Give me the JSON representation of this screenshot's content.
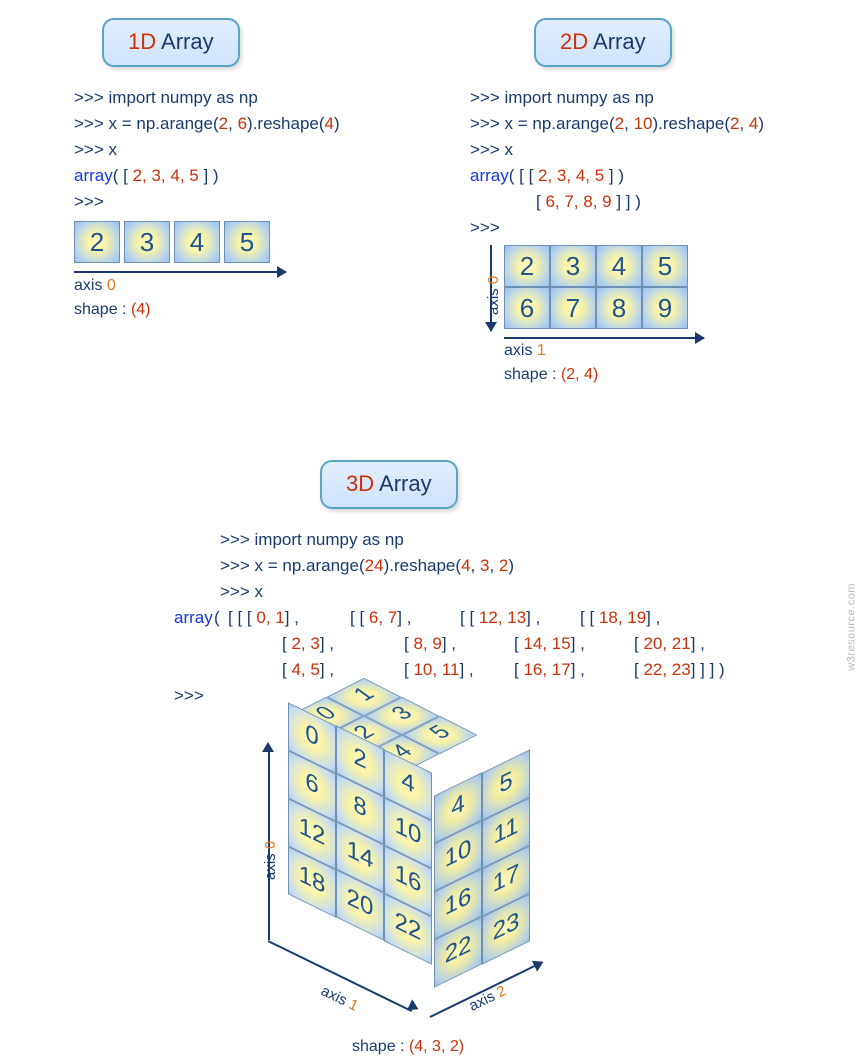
{
  "sections": {
    "d1": {
      "title_dim": "1D",
      "title_word": "Array",
      "code_lines": [
        {
          "prompt": ">>>",
          "parts": [
            {
              "t": " import numpy as np",
              "c": "kw-imp"
            }
          ]
        },
        {
          "prompt": ">>>",
          "parts": [
            {
              "t": " x =  np.arange",
              "c": "kw-fn"
            },
            {
              "t": "(",
              "c": "kw-fn"
            },
            {
              "t": "2",
              "c": "num"
            },
            {
              "t": ", ",
              "c": "kw-fn"
            },
            {
              "t": "6",
              "c": "num"
            },
            {
              "t": ")",
              "c": "kw-fn"
            },
            {
              "t": ".reshape",
              "c": "kw-fn"
            },
            {
              "t": "(",
              "c": "kw-fn"
            },
            {
              "t": "4",
              "c": "num"
            },
            {
              "t": ")",
              "c": "kw-fn"
            }
          ]
        },
        {
          "prompt": ">>>",
          "parts": [
            {
              "t": " x",
              "c": "kw-fn"
            }
          ]
        },
        {
          "prompt": "",
          "parts": [
            {
              "t": "array",
              "c": "kw-arr"
            },
            {
              "t": "( [ ",
              "c": "kw-fn"
            },
            {
              "t": "2, 3, 4, 5",
              "c": "num"
            },
            {
              "t": " ] )",
              "c": "kw-fn"
            }
          ]
        },
        {
          "prompt": ">>>",
          "parts": []
        }
      ],
      "cells": [
        "2",
        "3",
        "4",
        "5"
      ],
      "axis_label_pre": "axis ",
      "axis_label_num": "0",
      "shape_pre": "shape : ",
      "shape_val": "(4)"
    },
    "d2": {
      "title_dim": "2D",
      "title_word": "Array",
      "code_lines": [
        {
          "prompt": ">>>",
          "parts": [
            {
              "t": " import numpy as np",
              "c": "kw-imp"
            }
          ]
        },
        {
          "prompt": ">>>",
          "parts": [
            {
              "t": " x =  np.arange",
              "c": "kw-fn"
            },
            {
              "t": "(",
              "c": "kw-fn"
            },
            {
              "t": "2",
              "c": "num"
            },
            {
              "t": ", ",
              "c": "kw-fn"
            },
            {
              "t": "10",
              "c": "num"
            },
            {
              "t": ")",
              "c": "kw-fn"
            },
            {
              "t": ".reshape",
              "c": "kw-fn"
            },
            {
              "t": "(",
              "c": "kw-fn"
            },
            {
              "t": "2",
              "c": "num"
            },
            {
              "t": ", ",
              "c": "kw-fn"
            },
            {
              "t": "4",
              "c": "num"
            },
            {
              "t": ")",
              "c": "kw-fn"
            }
          ]
        },
        {
          "prompt": ">>>",
          "parts": [
            {
              "t": " x",
              "c": "kw-fn"
            }
          ]
        },
        {
          "prompt": "",
          "parts": [
            {
              "t": "array",
              "c": "kw-arr"
            },
            {
              "t": "( [ [ ",
              "c": "kw-fn"
            },
            {
              "t": "2, 3, 4, 5",
              "c": "num"
            },
            {
              "t": " ] )",
              "c": "kw-fn"
            }
          ]
        },
        {
          "prompt": "",
          "indent": 66,
          "parts": [
            {
              "t": "[ ",
              "c": "kw-fn"
            },
            {
              "t": "6, 7, 8, 9",
              "c": "num"
            },
            {
              "t": " ] ] )",
              "c": "kw-fn"
            }
          ]
        },
        {
          "prompt": ">>>",
          "parts": []
        }
      ],
      "rows": [
        [
          "2",
          "3",
          "4",
          "5"
        ],
        [
          "6",
          "7",
          "8",
          "9"
        ]
      ],
      "axis0": "axis 0",
      "axis1_pre": "axis ",
      "axis1_num": "1",
      "shape_pre": "shape : ",
      "shape_val": "(2, 4)"
    },
    "d3": {
      "title_dim": "3D",
      "title_word": "Array",
      "code_lines": [
        {
          "prompt": ">>>",
          "parts": [
            {
              "t": " import numpy as np",
              "c": "kw-imp"
            }
          ]
        },
        {
          "prompt": ">>>",
          "parts": [
            {
              "t": " x =  np.arange",
              "c": "kw-fn"
            },
            {
              "t": "(",
              "c": "kw-fn"
            },
            {
              "t": "24",
              "c": "num"
            },
            {
              "t": ")",
              "c": "kw-fn"
            },
            {
              "t": ".reshape",
              "c": "kw-fn"
            },
            {
              "t": "(",
              "c": "kw-fn"
            },
            {
              "t": "4",
              "c": "num"
            },
            {
              "t": ", ",
              "c": "kw-fn"
            },
            {
              "t": "3",
              "c": "num"
            },
            {
              "t": ", ",
              "c": "kw-fn"
            },
            {
              "t": "2",
              "c": "num"
            },
            {
              "t": ")",
              "c": "kw-fn"
            }
          ]
        },
        {
          "prompt": ">>>",
          "parts": [
            {
              "t": " x",
              "c": "kw-fn"
            }
          ]
        }
      ],
      "array_rows": [
        [
          {
            "open": "[ [ [ ",
            "vals": "0, 1",
            "close": "] ,"
          },
          {
            "open": "[ [ ",
            "vals": "6, 7",
            "close": "] ,"
          },
          {
            "open": "[ [ ",
            "vals": "12, 13",
            "close": "] ,"
          },
          {
            "open": "[ [ ",
            "vals": "18, 19",
            "close": "] ,"
          }
        ],
        [
          {
            "open": "[ ",
            "vals": "2, 3",
            "close": "] ,"
          },
          {
            "open": "[ ",
            "vals": "8, 9",
            "close": "] ,"
          },
          {
            "open": "[ ",
            "vals": "14, 15",
            "close": "] ,"
          },
          {
            "open": "[ ",
            "vals": "20, 21",
            "close": "] ,"
          }
        ],
        [
          {
            "open": "[ ",
            "vals": "4, 5",
            "close": "] ,"
          },
          {
            "open": "[ ",
            "vals": "10, 11",
            "close": "] ,"
          },
          {
            "open": "[ ",
            "vals": "16, 17",
            "close": "] ,"
          },
          {
            "open": "[ ",
            "vals": "22, 23",
            "close": "] ] ] )"
          }
        ]
      ],
      "array_keyword": "array",
      "trailing_prompt": ">>>",
      "front_face": [
        [
          "0",
          "2",
          "4"
        ],
        [
          "6",
          "8",
          "10"
        ],
        [
          "12",
          "14",
          "16"
        ],
        [
          "18",
          "20",
          "22"
        ]
      ],
      "right_face": [
        [
          "4",
          "5"
        ],
        [
          "10",
          "11"
        ],
        [
          "16",
          "17"
        ],
        [
          "22",
          "23"
        ]
      ],
      "top_face": [
        [
          "0",
          "1"
        ],
        [
          "2",
          "3"
        ],
        [
          "4",
          "5"
        ]
      ],
      "axis0": "axis 0",
      "axis1": "axis 1",
      "axis2": "axis 2",
      "shape_pre": "shape : ",
      "shape_val": "(4, 3, 2)"
    }
  },
  "watermark": "w3resource.com"
}
